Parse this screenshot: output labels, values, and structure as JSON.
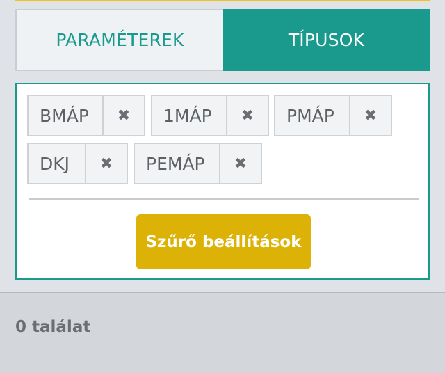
{
  "tabs": {
    "parameters": "PARAMÉTEREK",
    "types": "TÍPUSOK"
  },
  "active_tab": "types",
  "chips": [
    {
      "label": "BMÁP",
      "remove": "✖"
    },
    {
      "label": "1MÁP",
      "remove": "✖"
    },
    {
      "label": "PMÁP",
      "remove": "✖"
    },
    {
      "label": "DKJ",
      "remove": "✖"
    },
    {
      "label": "PEMÁP",
      "remove": "✖"
    }
  ],
  "filter_button": "Szűrő beállítások",
  "results": "0 találat",
  "colors": {
    "accent": "#1a9a8c",
    "button": "#ddb206"
  }
}
